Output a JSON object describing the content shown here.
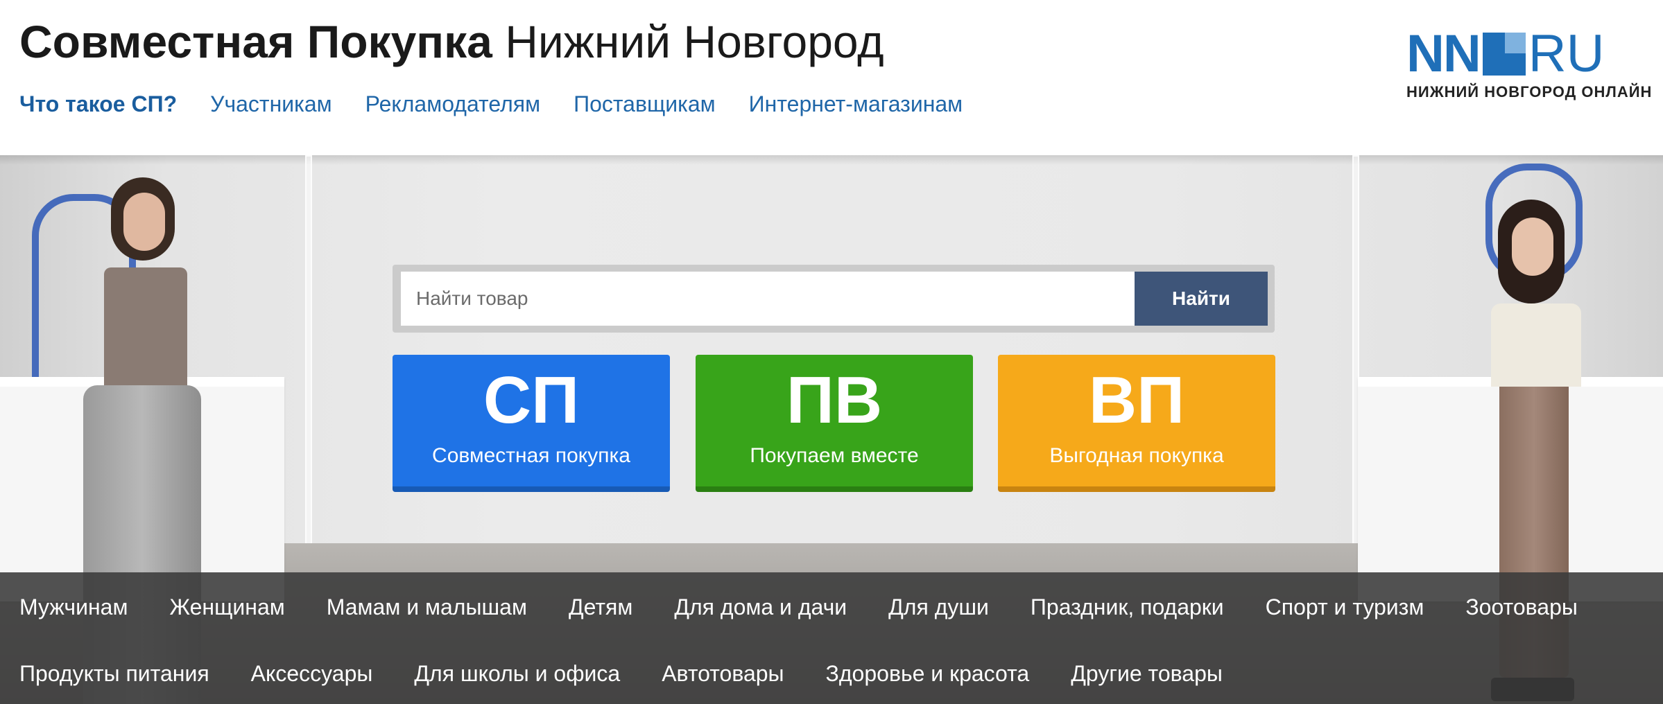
{
  "header": {
    "title_bold": "Совместная Покупка",
    "title_city": "Нижний Новгород",
    "nav": [
      {
        "label": "Что такое СП?",
        "active": true
      },
      {
        "label": "Участникам"
      },
      {
        "label": "Рекламодателям"
      },
      {
        "label": "Поставщикам"
      },
      {
        "label": "Интернет-магазинам"
      }
    ]
  },
  "logo": {
    "mark_left": "NN",
    "mark_right": "RU",
    "subtitle": "НИЖНИЙ НОВГОРОД ОНЛАЙН",
    "color": "#1f6fb8"
  },
  "search": {
    "placeholder": "Найти товар",
    "value": "",
    "button_label": "Найти",
    "button_color": "#3e5579"
  },
  "tiles": [
    {
      "abbr": "СП",
      "label": "Совместная покупка",
      "color": "#1f73e6"
    },
    {
      "abbr": "ПВ",
      "label": "Покупаем вместе",
      "color": "#38a41a"
    },
    {
      "abbr": "ВП",
      "label": "Выгодная покупка",
      "color": "#f6a91a"
    }
  ],
  "categories": {
    "row1": [
      "Мужчинам",
      "Женщинам",
      "Мамам и малышам",
      "Детям",
      "Для дома и дачи",
      "Для души",
      "Праздник, подарки",
      "Спорт и туризм",
      "Зоотовары"
    ],
    "row2": [
      "Продукты питания",
      "Аксессуары",
      "Для школы и офиса",
      "Автотовары",
      "Здоровье и красота",
      "Другие товары"
    ]
  }
}
